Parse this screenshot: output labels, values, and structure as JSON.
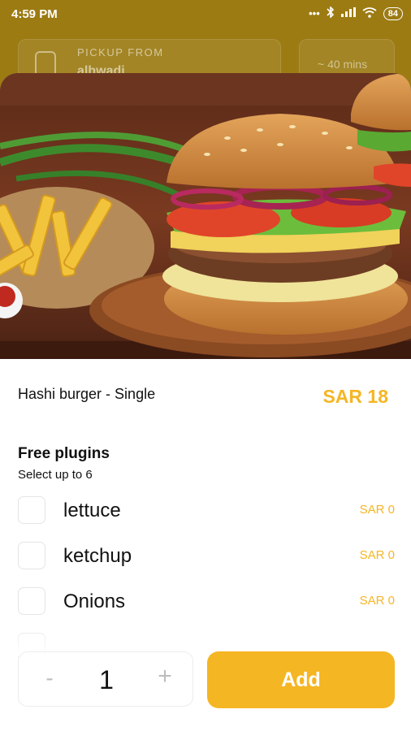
{
  "status_bar": {
    "time": "4:59 PM",
    "icons": [
      "signal-dots-icon",
      "bluetooth-icon",
      "cell-signal-icon",
      "wifi-icon",
      "battery-icon"
    ],
    "battery_level": "84"
  },
  "background": {
    "pickup_label": "PICKUP FROM",
    "pickup_value": "alhwadi",
    "eta": "~ 40 mins"
  },
  "item": {
    "name": "Hashi burger - Single",
    "price": "SAR 18"
  },
  "addons": {
    "title": "Free plugins",
    "subtitle": "Select up to 6",
    "options": [
      {
        "label": "lettuce",
        "price": "SAR 0"
      },
      {
        "label": "ketchup",
        "price": "SAR 0"
      },
      {
        "label": "Onions",
        "price": "SAR 0"
      }
    ]
  },
  "footer": {
    "minus": "-",
    "quantity": "1",
    "plus": "+",
    "add_label": "Add"
  },
  "colors": {
    "accent": "#f5b623",
    "background_overlay": "#9c7b13"
  }
}
